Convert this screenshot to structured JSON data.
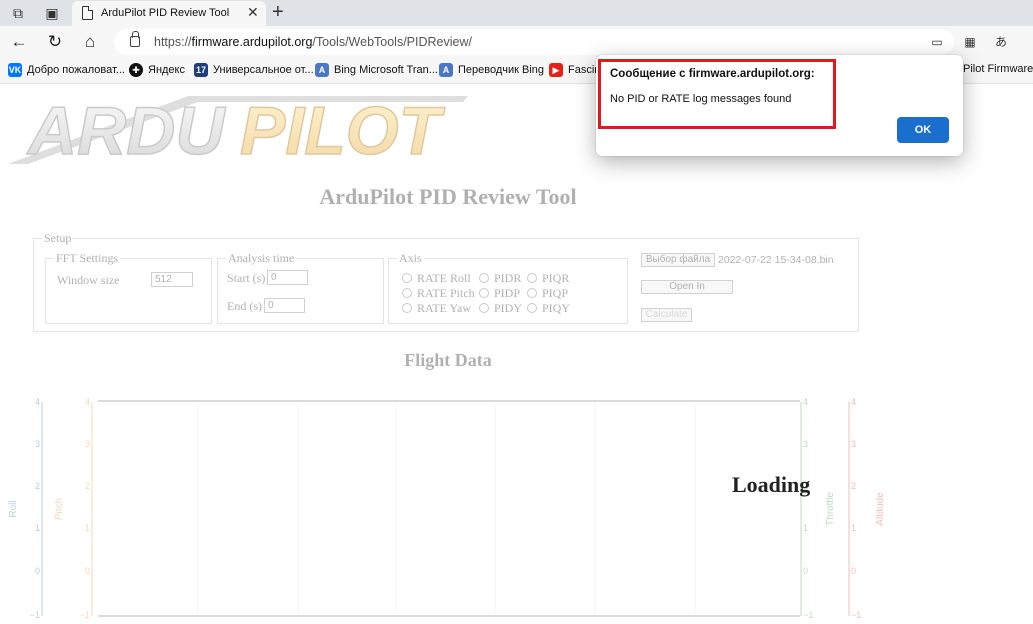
{
  "browser": {
    "tab": {
      "title": "ArduPilot PID Review Tool",
      "close_glyph": "✕"
    },
    "new_tab_glyph": "+",
    "url": {
      "prefix": "https://",
      "host": "firmware.ardupilot.org",
      "path": "/Tools/WebTools/PIDReview/"
    },
    "bookmarks": [
      {
        "label": "Добро пожаловат...",
        "icon": "vk-icon",
        "color": "#0077ff",
        "glyph": "VK"
      },
      {
        "label": "Яндекс",
        "icon": "yandex-icon",
        "color": "#111111",
        "glyph": "✚"
      },
      {
        "label": "Универсальное от...",
        "icon": "17-icon",
        "color": "#1f3d7a",
        "glyph": "17"
      },
      {
        "label": "Bing Microsoft Tran...",
        "icon": "bing-translator-icon",
        "color": "#4a78c2",
        "glyph": "A"
      },
      {
        "label": "Переводчик Bing",
        "icon": "bing-translator-icon",
        "color": "#4a78c2",
        "glyph": "A"
      },
      {
        "label": "Fascin",
        "icon": "youtube-icon",
        "color": "#e62117",
        "glyph": "▶"
      },
      {
        "label": "Pilot Firmware...",
        "icon": "ardupilot-icon",
        "color": "#ffffff",
        "glyph": ""
      }
    ]
  },
  "page": {
    "title": "ArduPilot PID Review Tool",
    "setup": {
      "legend": "Setup",
      "fft": {
        "legend": "FFT Settings",
        "window_label": "Window size",
        "window_value": "512"
      },
      "analysis": {
        "legend": "Analysis time",
        "start_label": "Start (s)",
        "start_value": "0",
        "end_label": "End (s)",
        "end_value": "0"
      },
      "axis": {
        "legend": "Axis",
        "col1": [
          "RATE Roll",
          "RATE Pitch",
          "RATE Yaw"
        ],
        "col2": [
          "PIDR",
          "PIDP",
          "PIDY"
        ],
        "col3": [
          "PIQR",
          "PIQP",
          "PIQY"
        ]
      },
      "file_button": "Выбор файла",
      "file_name": "2022-07-22 15-34-08.bin",
      "open_in": "Open In",
      "calculate": "Calculate"
    },
    "flight_data_title": "Flight Data",
    "chart": {
      "y_ticks": [
        "4",
        "3",
        "2",
        "1",
        "0",
        "−1"
      ],
      "left_axes": [
        {
          "label": "Roll",
          "color": "#4d7fa6"
        },
        {
          "label": "Pitch",
          "color": "#e59a4a"
        }
      ],
      "right_axes": [
        {
          "label": "Throttle",
          "color": "#5aa05a"
        },
        {
          "label": "Altitude",
          "color": "#d9534f"
        }
      ]
    },
    "loading": "Loading"
  },
  "dialog": {
    "title": "Сообщение с firmware.ardupilot.org:",
    "message": "No PID or RATE log messages found",
    "ok_label": "OK"
  }
}
